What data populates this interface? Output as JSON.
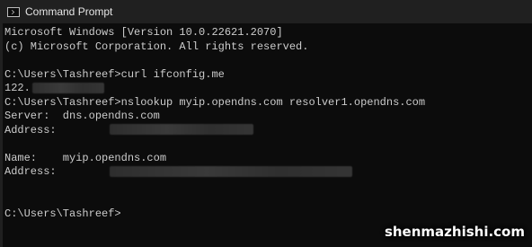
{
  "window": {
    "title": "Command Prompt"
  },
  "console": {
    "banner_line1": "Microsoft Windows [Version 10.0.22621.2070]",
    "banner_line2": "(c) Microsoft Corporation. All rights reserved.",
    "cmd1": "C:\\Users\\Tashreef>curl ifconfig.me",
    "cmd1_output_prefix": "122.",
    "cmd2": "C:\\Users\\Tashreef>nslookup myip.opendns.com resolver1.opendns.com",
    "server_line": "Server:  dns.opendns.com",
    "address_label1": "Address:",
    "name_line": "Name:    myip.opendns.com",
    "address_label2": "Address:",
    "prompt": "C:\\Users\\Tashreef>"
  },
  "watermark": "shenmazhishi.com"
}
